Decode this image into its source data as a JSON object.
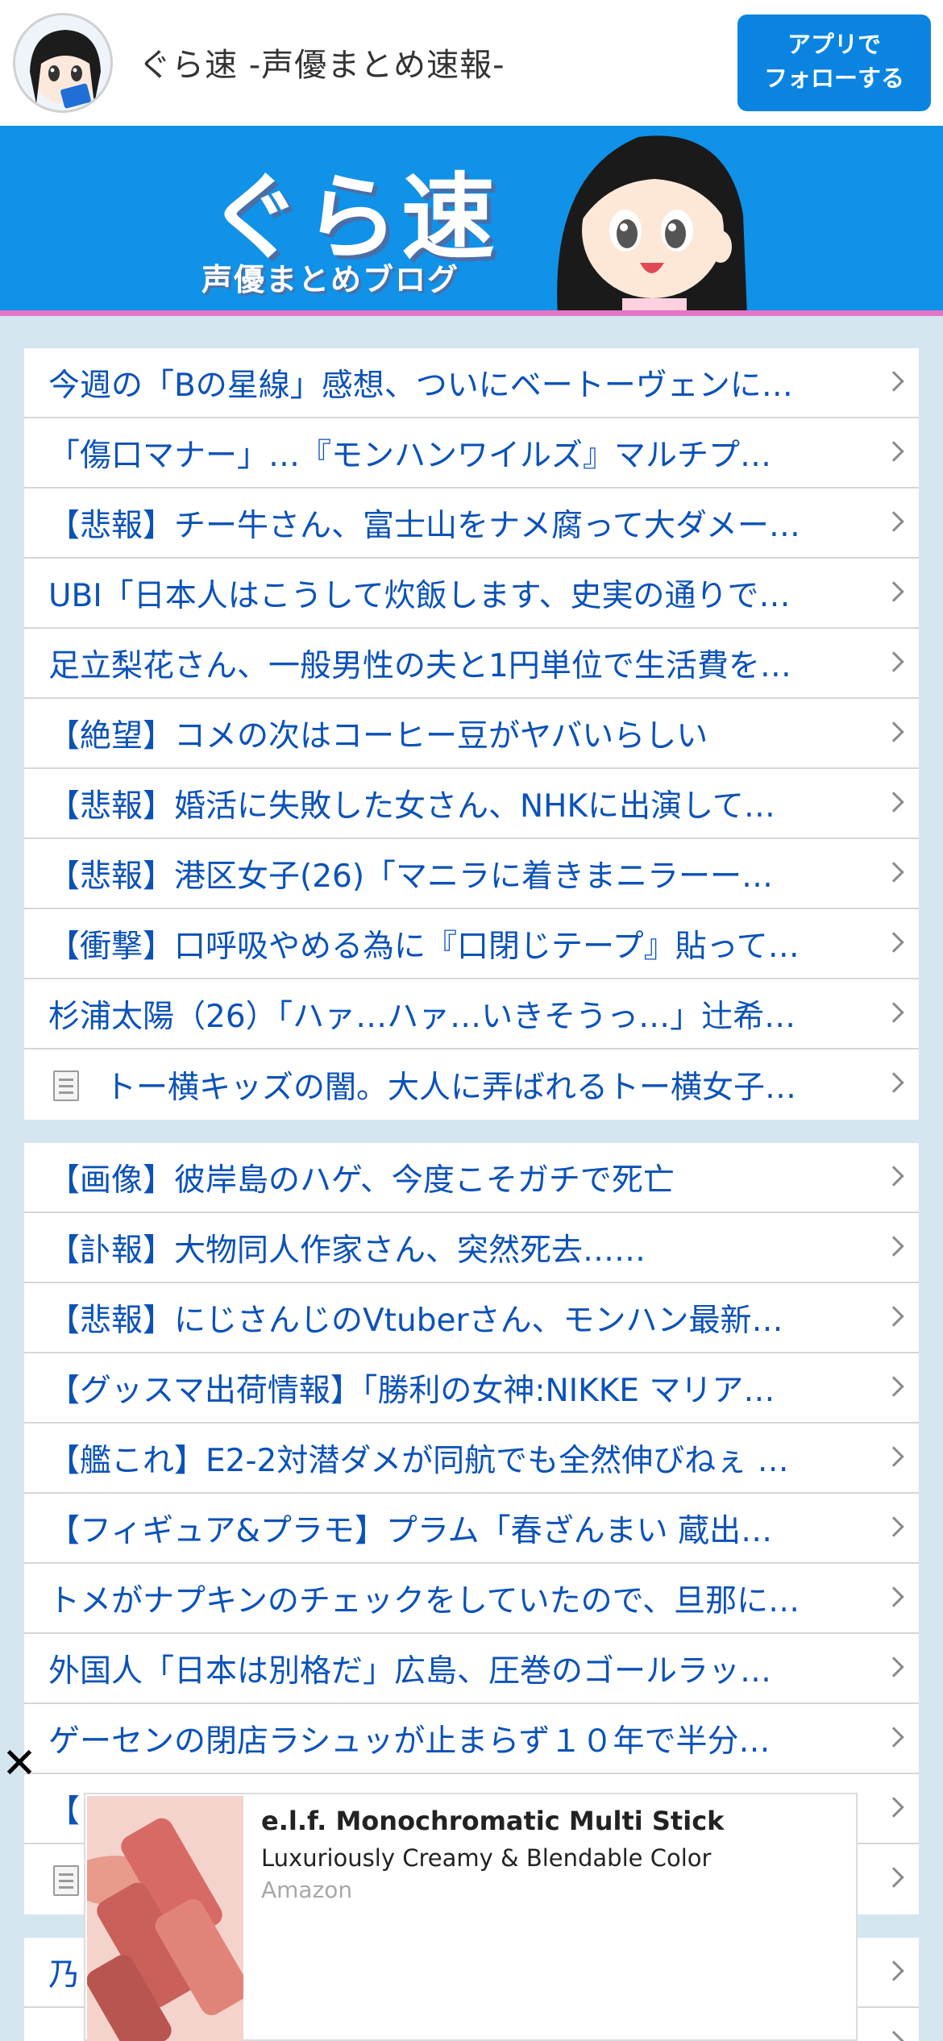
{
  "header": {
    "site_title": "ぐら速 -声優まとめ速報-",
    "follow_button": "アプリで\nフォローする"
  },
  "banner": {
    "logo_main": "ぐら速",
    "logo_sub": "声優まとめブログ"
  },
  "list1": [
    {
      "title": "今週の「Bの星線」感想、ついにベートーヴェンに…",
      "doc": false
    },
    {
      "title": "「傷口マナー」…『モンハンワイルズ』マルチプ…",
      "doc": false
    },
    {
      "title": "【悲報】チー牛さん、富士山をナメ腐って大ダメー…",
      "doc": false
    },
    {
      "title": "UBI「日本人はこうして炊飯します、史実の通りで…",
      "doc": false
    },
    {
      "title": "足立梨花さん、一般男性の夫と1円単位で生活費を…",
      "doc": false
    },
    {
      "title": "【絶望】コメの次はコーヒー豆がヤバいらしい",
      "doc": false
    },
    {
      "title": "【悲報】婚活に失敗した女さん、NHKに出演して…",
      "doc": false
    },
    {
      "title": "【悲報】港区女子(26)「マニラに着きまニラーー…",
      "doc": false
    },
    {
      "title": "【衝撃】口呼吸やめる為に『口閉じテープ』貼って…",
      "doc": false
    },
    {
      "title": "杉浦太陽（26）「ハァ…ハァ…いきそうっ…」辻希…",
      "doc": false
    },
    {
      "title": "トー横キッズの闇。大人に弄ばれるトー横女子…",
      "doc": true
    }
  ],
  "list2": [
    {
      "title": "【画像】彼岸島のハゲ、今度こそガチで死亡",
      "doc": false
    },
    {
      "title": "【訃報】大物同人作家さん、突然死去……",
      "doc": false
    },
    {
      "title": "【悲報】にじさんじのVtuberさん、モンハン最新…",
      "doc": false
    },
    {
      "title": "【グッスマ出荷情報】「勝利の女神:NIKKE マリア…",
      "doc": false
    },
    {
      "title": "【艦これ】E2-2対潜ダメが同航でも全然伸びねぇ …",
      "doc": false
    },
    {
      "title": "【フィギュア&プラモ】プラム「春ざんまい 蔵出…",
      "doc": false
    },
    {
      "title": "トメがナプキンのチェックをしていたので、旦那に…",
      "doc": false
    },
    {
      "title": "外国人「日本は別格だ」広島、圧巻のゴールラッ…",
      "doc": false
    },
    {
      "title": "ゲーセンの閉店ラシュッが止まらず１０年で半分…",
      "doc": false
    },
    {
      "title": "【",
      "doc": false
    },
    {
      "title": "",
      "doc": true
    }
  ],
  "list3": [
    {
      "title": "乃",
      "doc": false
    },
    {
      "title": "",
      "doc": false
    }
  ],
  "ad": {
    "close_glyph": "✕",
    "title": "e.l.f. Monochromatic Multi Stick",
    "subtitle": "Luxuriously Creamy & Blendable Color",
    "source": "Amazon"
  },
  "colors": {
    "link": "#0b52b8",
    "banner": "#0f92e8",
    "accent_line": "#e276c6",
    "button": "#0a84e0",
    "page_bg": "#d5e6f1"
  }
}
